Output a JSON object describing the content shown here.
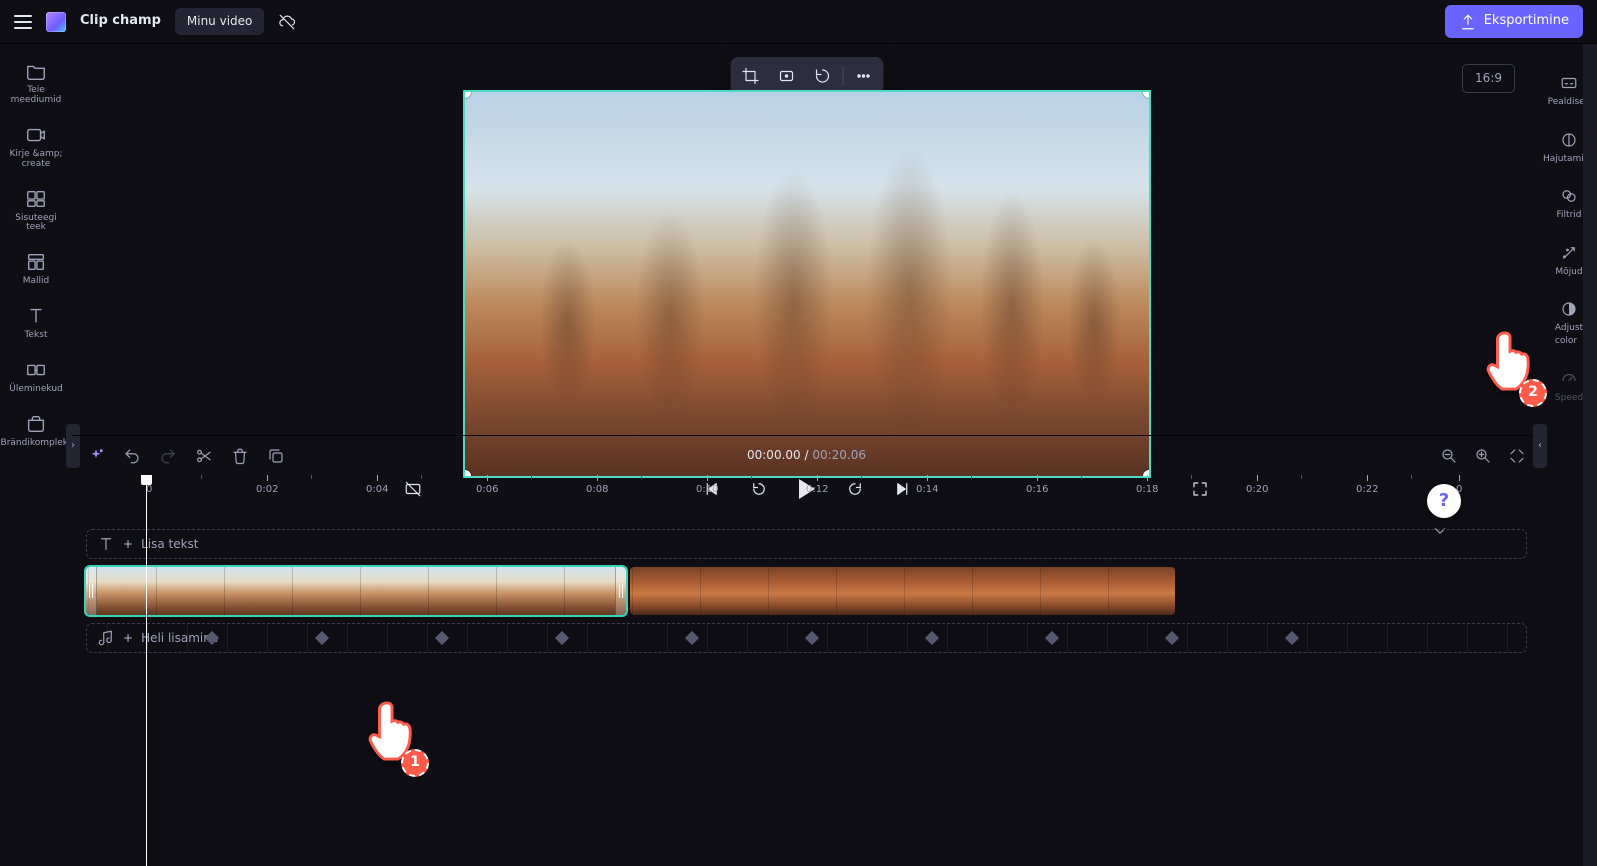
{
  "app": {
    "name": "Clip champ"
  },
  "project": {
    "title": "Minu video"
  },
  "topbar": {
    "export_label": "Eksportimine"
  },
  "left_sidebar": {
    "items": [
      {
        "id": "your-media",
        "label": "Teie meediumid"
      },
      {
        "id": "record-create",
        "label": "Kirje &amp;\ncreate"
      },
      {
        "id": "content-lib",
        "label": "Sisuteegi\nteek"
      },
      {
        "id": "templates",
        "label": "Mallid"
      },
      {
        "id": "text",
        "label": "Tekst"
      },
      {
        "id": "transitions",
        "label": "Üleminekud"
      },
      {
        "id": "brand-kit",
        "label": "Brändikomplekt"
      }
    ]
  },
  "right_sidebar": {
    "items": [
      {
        "id": "captions",
        "label": "Pealdised"
      },
      {
        "id": "fade",
        "label": "Hajutamine"
      },
      {
        "id": "filters",
        "label": "Filtrid"
      },
      {
        "id": "effects",
        "label": "Mõjud"
      },
      {
        "id": "adjust-color",
        "label": "Adjust\ncolor"
      },
      {
        "id": "speed",
        "label": "Speed"
      }
    ]
  },
  "stage": {
    "aspect_label": "16:9"
  },
  "playback": {
    "current": "00:00.00",
    "separator": " / ",
    "duration": "00:20.06"
  },
  "timeline": {
    "text_track_hint": "Lisa tekst",
    "audio_track_hint": "Heli lisamine",
    "ruler_marks": [
      "0",
      "0:02",
      "0:04",
      "0:06",
      "0:08",
      "0:10",
      "0:12",
      "0:14",
      "0:16",
      "0:18",
      "0:20",
      "0:22",
      "0"
    ]
  },
  "annotations": {
    "hand1_badge": "1",
    "hand2_badge": "2"
  },
  "help": {
    "glyph": "?"
  }
}
